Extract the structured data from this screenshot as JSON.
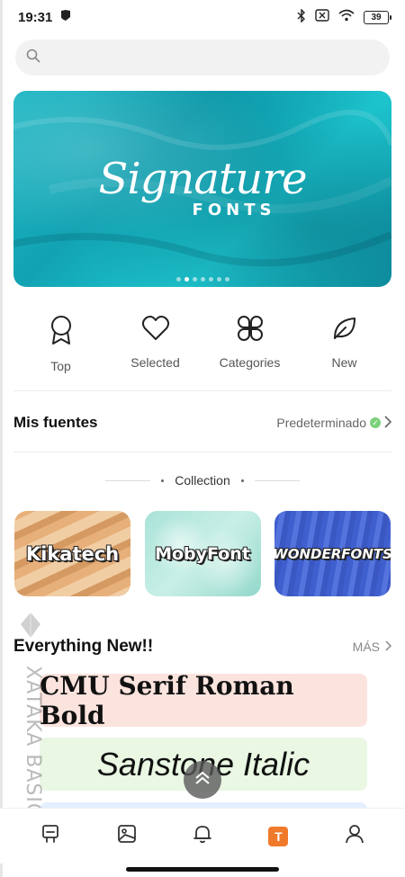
{
  "status_bar": {
    "time": "19:31",
    "battery": "39",
    "icons": [
      "shield-icon",
      "bluetooth-icon",
      "sim-off-icon",
      "wifi-icon",
      "battery-icon"
    ]
  },
  "search": {
    "placeholder": "",
    "icon": "search-icon"
  },
  "banner": {
    "script_text": "Signature",
    "sub_text": "FONTS",
    "slide_count": 7,
    "active_slide": 2
  },
  "categories": [
    {
      "label": "Top",
      "icon": "award-ribbon-icon"
    },
    {
      "label": "Selected",
      "icon": "heart-icon"
    },
    {
      "label": "Categories",
      "icon": "four-leaf-grid-icon"
    },
    {
      "label": "New",
      "icon": "leaf-icon"
    }
  ],
  "mis_fuentes": {
    "title": "Mis fuentes",
    "default_label": "Predeterminado"
  },
  "collection": {
    "heading": "Collection",
    "cards": [
      {
        "label": "Kikatech"
      },
      {
        "label": "MobyFont"
      },
      {
        "label": "WONDERFONTS"
      }
    ]
  },
  "everything_new": {
    "title": "Everything New!!",
    "more_label": "MÁS",
    "fonts": [
      {
        "name": "CMU Serif Roman Bold",
        "bg": "#fbe3de"
      },
      {
        "name": "Sanstone Italic",
        "bg": "#e9f7e3"
      }
    ]
  },
  "watermark": {
    "text": "XATAKA BASICS"
  },
  "bottom_nav": {
    "items": [
      {
        "icon": "desk-icon"
      },
      {
        "icon": "image-frame-icon"
      },
      {
        "icon": "bell-icon"
      },
      {
        "icon": "t-badge-icon",
        "label": "T",
        "active": true
      },
      {
        "icon": "profile-icon"
      }
    ],
    "accent": "#f07a2c"
  }
}
